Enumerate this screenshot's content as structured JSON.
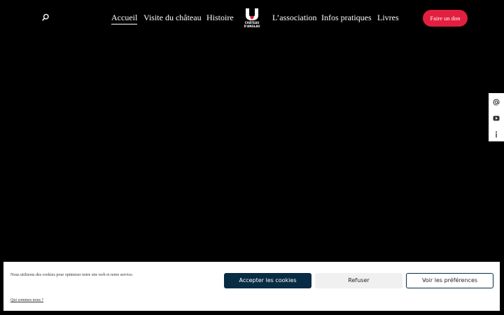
{
  "header": {
    "nav": [
      {
        "label": "Accueil",
        "active": true
      },
      {
        "label": "Visite du château",
        "active": false
      },
      {
        "label": "Histoire",
        "active": false
      },
      {
        "label": "L’association",
        "active": false
      },
      {
        "label": "Infos pratiques",
        "active": false
      },
      {
        "label": "Livres",
        "active": false
      }
    ],
    "logo": {
      "line1": "CHÂTEAU",
      "line2": "D'ANGLAU"
    },
    "donate_label": "Faire un don"
  },
  "side_tools": [
    "email-icon",
    "youtube-icon",
    "info-icon"
  ],
  "cookie_banner": {
    "text": "Nous utilisons des cookies pour optimiser notre site web et notre service.",
    "link": "Qui sommes nous ?",
    "accept_label": "Accepter les cookies",
    "refuse_label": "Refuser",
    "prefs_label": "Voir les préférences"
  },
  "colors": {
    "background": "#000000",
    "donate": "#e31f3f",
    "accept_button": "#082c44"
  }
}
